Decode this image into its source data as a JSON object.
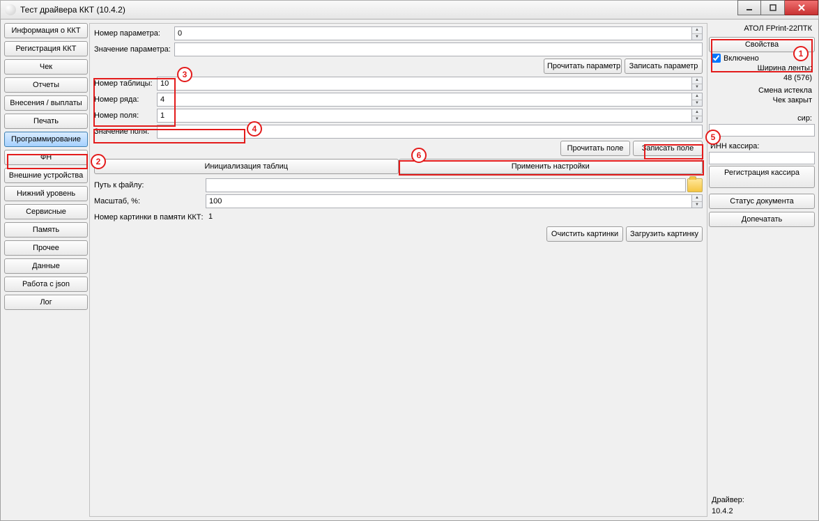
{
  "window": {
    "title": "Тест драйвера ККТ (10.4.2)"
  },
  "sidebar": {
    "items": [
      "Информация о ККТ",
      "Регистрация ККТ",
      "Чек",
      "Отчеты",
      "Внесения / выплаты",
      "Печать",
      "Программирование",
      "ФН",
      "Внешние устройства",
      "Нижний уровень",
      "Сервисные",
      "Память",
      "Прочее",
      "Данные",
      "Работа с json",
      "Лог"
    ],
    "selected_index": 6
  },
  "main": {
    "param_number_label": "Номер параметра:",
    "param_number_value": "0",
    "param_value_label": "Значение параметра:",
    "param_value_value": "",
    "read_param_btn": "Прочитать параметр",
    "write_param_btn": "Записать параметр",
    "table_number_label": "Номер таблицы:",
    "table_number_value": "10",
    "row_number_label": "Номер ряда:",
    "row_number_value": "4",
    "field_number_label": "Номер поля:",
    "field_number_value": "1",
    "field_value_label": "Значение поля:",
    "field_value_value": "",
    "read_field_btn": "Прочитать поле",
    "write_field_btn": "Записать поле",
    "init_tables_btn": "Инициализация таблиц",
    "apply_settings_btn": "Применить настройки",
    "file_path_label": "Путь к файлу:",
    "file_path_value": "",
    "scale_label": "Масштаб, %:",
    "scale_value": "100",
    "image_number_label": "Номер картинки в памяти ККТ:",
    "image_number_value": "1",
    "clear_images_btn": "Очистить картинки",
    "load_image_btn": "Загрузить картинку"
  },
  "right": {
    "device_name": "АТОЛ FPrint-22ПТК",
    "properties_btn": "Свойства",
    "enabled_label": "Включено",
    "enabled_checked": true,
    "tape_width_label": "Ширина ленты:",
    "tape_width_value": "48 (576)",
    "shift_status": "Смена истекла",
    "check_status": "Чек закрыт",
    "cashier_label": "сир:",
    "cashier_inn_label": "ИНН кассира:",
    "register_cashier_btn": "Регистрация кассира",
    "doc_status_btn": "Статус документа",
    "reprint_btn": "Допечатать",
    "driver_label": "Драйвер:",
    "driver_version": "10.4.2"
  },
  "annotations": {
    "b1": "1",
    "b2": "2",
    "b3": "3",
    "b4": "4",
    "b5": "5",
    "b6": "6"
  }
}
